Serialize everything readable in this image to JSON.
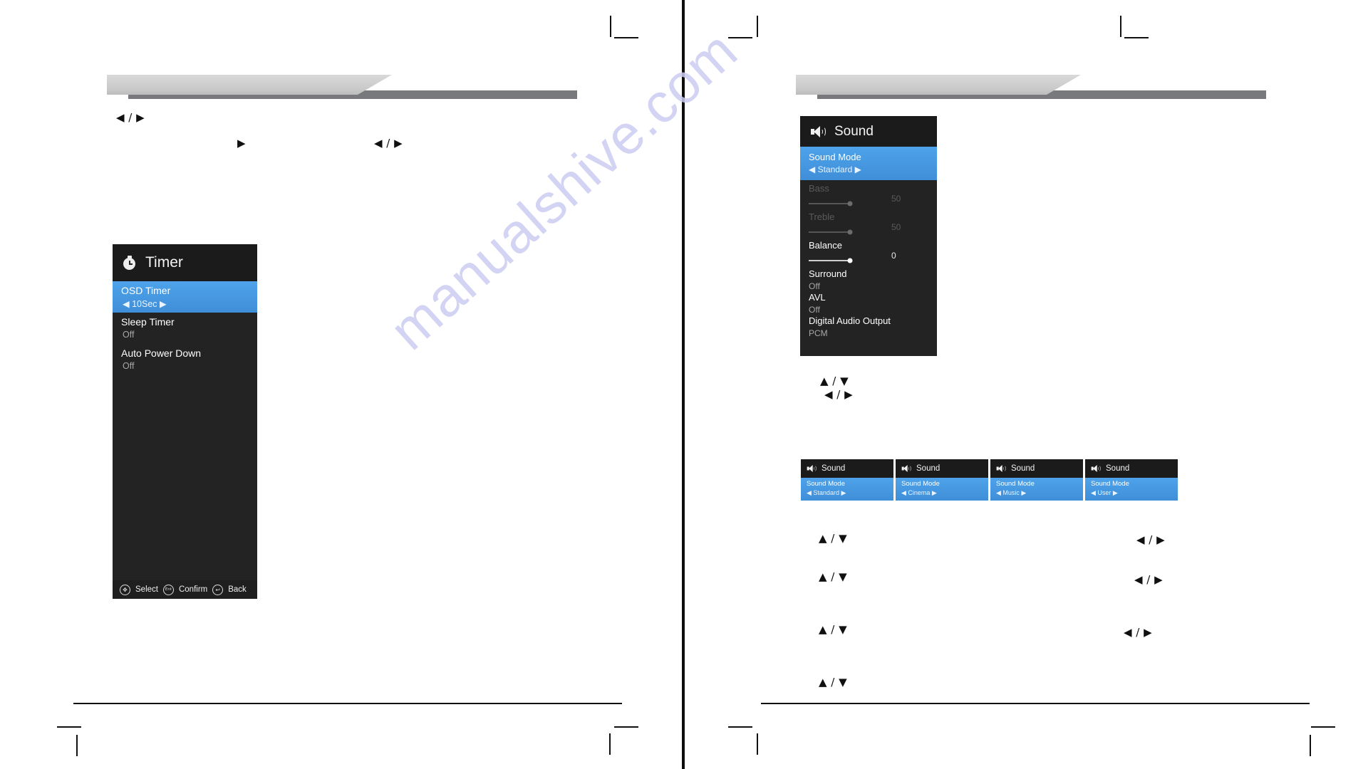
{
  "watermark": {
    "text": "manualshive.com"
  },
  "left_page": {
    "nav_hint_1": "◀ / ▶",
    "nav_hint_2": "▶",
    "nav_hint_3": "◀ / ▶",
    "timer_menu": {
      "title": "Timer",
      "title_icon": "clock-icon",
      "rows": [
        {
          "label": "OSD Timer",
          "value": "◀ 10Sec ▶",
          "state": "selected"
        },
        {
          "label": "Sleep Timer",
          "value": "Off",
          "state": "normal"
        },
        {
          "label": "Auto Power Down",
          "value": "Off",
          "state": "normal"
        }
      ],
      "footer": [
        {
          "icon": "dpad-icon",
          "glyph": "✥",
          "label": "Select"
        },
        {
          "icon": "enter-icon",
          "glyph": "Enter",
          "label": "Confirm"
        },
        {
          "icon": "return-icon",
          "glyph": "↩",
          "label": "Back"
        }
      ]
    }
  },
  "right_page": {
    "sound_menu": {
      "title": "Sound",
      "title_icon": "speaker-icon",
      "rows": [
        {
          "label": "Sound Mode",
          "value": "◀ Standard ▶",
          "state": "selected",
          "kind": "option"
        },
        {
          "label": "Bass",
          "value": "50",
          "state": "dimmed",
          "kind": "slider",
          "fill": 100
        },
        {
          "label": "Treble",
          "value": "50",
          "state": "dimmed",
          "kind": "slider",
          "fill": 100
        },
        {
          "label": "Balance",
          "value": "0",
          "state": "normal",
          "kind": "slider",
          "fill": 100
        },
        {
          "label": "Surround",
          "value": "Off",
          "state": "normal",
          "kind": "text"
        },
        {
          "label": "AVL",
          "value": "Off",
          "state": "normal",
          "kind": "text"
        },
        {
          "label": "Digital Audio Output",
          "value": "PCM",
          "state": "normal",
          "kind": "text"
        }
      ]
    },
    "nav_hints_top": [
      "▲ / ▼",
      "◀ / ▶"
    ],
    "mode_thumbnails": [
      {
        "title": "Sound",
        "label": "Sound Mode",
        "value": "◀ Standard ▶"
      },
      {
        "title": "Sound",
        "label": "Sound Mode",
        "value": "◀ Cinema ▶"
      },
      {
        "title": "Sound",
        "label": "Sound Mode",
        "value": "◀ Music ▶"
      },
      {
        "title": "Sound",
        "label": "Sound Mode",
        "value": "◀ User ▶"
      }
    ],
    "nav_hint_rows": [
      {
        "left": "▲ / ▼",
        "right": "◀ / ▶"
      },
      {
        "left": "▲ / ▼",
        "right": "◀ / ▶"
      },
      {
        "left": "▲ / ▼",
        "right": "◀ / ▶"
      },
      {
        "left": "▲ / ▼",
        "right": ""
      }
    ]
  },
  "colors": {
    "osd_background": "#232323",
    "osd_header": "#1b1b1b",
    "highlight_blue": "#4ea3ea",
    "banner_light": "#d0d0d0",
    "banner_dark": "#77797c",
    "watermark": "#ccccf2"
  }
}
